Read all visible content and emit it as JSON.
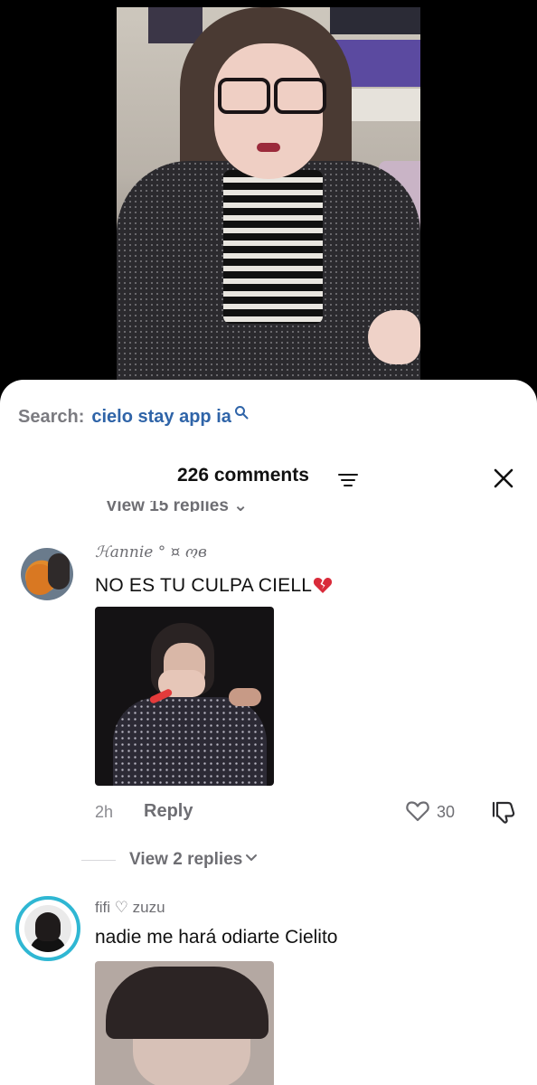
{
  "search": {
    "label": "Search:",
    "query": "cielo stay app ia"
  },
  "header": {
    "comments_count": "226 comments"
  },
  "replies_top": {
    "label": "View 15 replies ⌄"
  },
  "comments": [
    {
      "username": "ℋannie ° ¤ ოв",
      "text": "NO ES TU CULPA CIELL",
      "time": "2h",
      "reply_label": "Reply",
      "likes": "30",
      "view_replies": "View 2 replies"
    },
    {
      "username": "fifi ♡ zuzu",
      "text": "nadie me hará odiarte Cielito"
    }
  ],
  "colors": {
    "search_query": "#2f64a8",
    "avatar_ring": "#2fb7d3"
  }
}
